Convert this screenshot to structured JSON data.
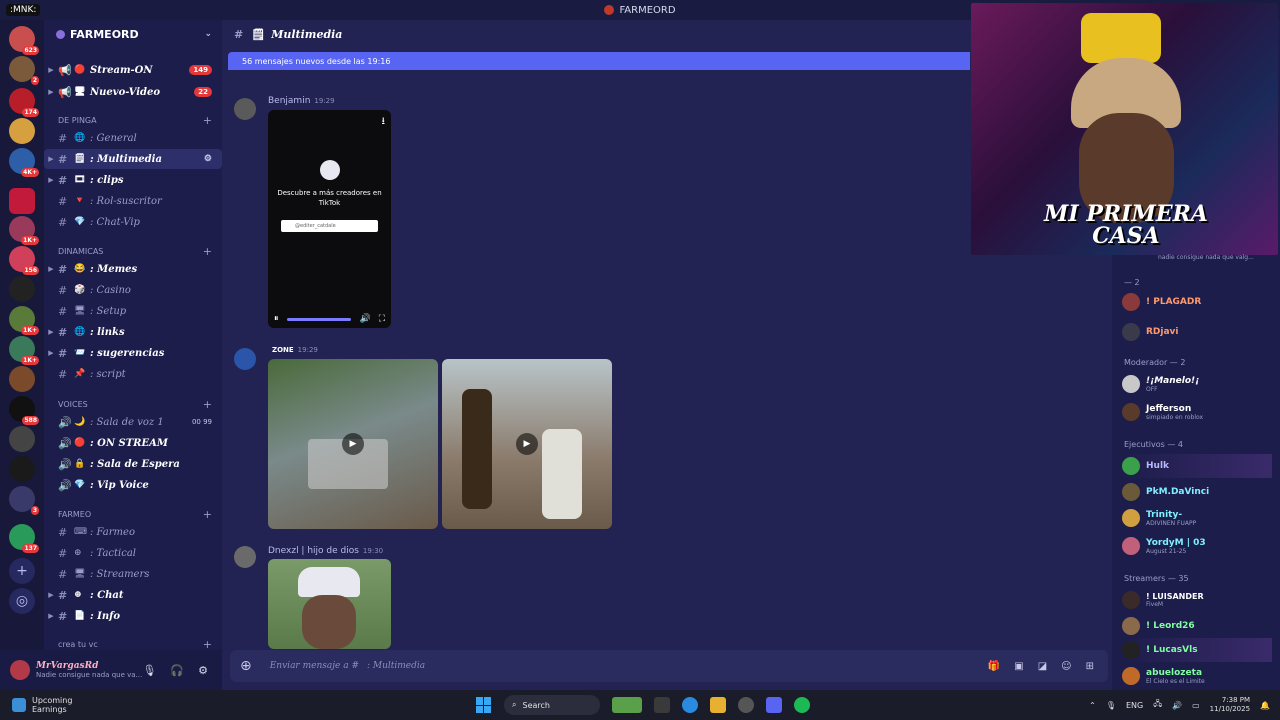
{
  "window": {
    "title": "FARMEORD",
    "overlay_tag": ":MNK:"
  },
  "guilds": {
    "badges": [
      "623",
      "2",
      "174",
      "8",
      "4K+",
      "1K+",
      "156",
      "1K+",
      "1K+",
      "588",
      "3",
      "137"
    ]
  },
  "server": {
    "name": "FARMEORD",
    "channels_top": [
      {
        "label": "Stream-ON",
        "count": "149"
      },
      {
        "label": "Nuevo-Video",
        "count": "22"
      }
    ],
    "categories": [
      {
        "name": "DE PINGA",
        "channels": [
          {
            "label": ": General"
          },
          {
            "label": ": Multimedia"
          },
          {
            "label": ": clips"
          },
          {
            "label": ": Rol-suscritor"
          },
          {
            "label": ": Chat-Vip"
          }
        ]
      },
      {
        "name": "DINAMICAS",
        "channels": [
          {
            "label": ": Memes"
          },
          {
            "label": ": Casino"
          },
          {
            "label": ": Setup"
          },
          {
            "label": ": links"
          },
          {
            "label": ": sugerencias"
          },
          {
            "label": ": script"
          }
        ]
      },
      {
        "name": "VOICES",
        "channels": [
          {
            "label": ": Sala de voz 1",
            "extra": "00  99"
          },
          {
            "label": ": ON STREAM"
          },
          {
            "label": ": Sala de Espera"
          },
          {
            "label": ": Vip Voice"
          }
        ]
      },
      {
        "name": "FARMEO",
        "channels": [
          {
            "label": ": Farmeo"
          },
          {
            "label": ": Tactical"
          },
          {
            "label": ": Streamers"
          },
          {
            "label": ": Chat"
          },
          {
            "label": ": Info"
          }
        ]
      },
      {
        "name": "crea tu vc",
        "channels": []
      }
    ]
  },
  "user": {
    "name": "MrVargasRd",
    "status": "Nadie consigue nada que va..."
  },
  "chat": {
    "channel": "Multimedia",
    "new_messages_bar": "56 mensajes nuevos desde las 19:16",
    "messages": [
      {
        "author": "Benjamin",
        "time": "19:29",
        "video": {
          "promo": "Descubre a más creadores en TikTok",
          "search": "@editer_catdale"
        }
      },
      {
        "author": "",
        "tag": "ZONE",
        "time": "19:29"
      },
      {
        "author": "Dnexzl | hijo de dios",
        "time": "19:30"
      }
    ],
    "composer_placeholder": "Enviar mensaje a # ",
    "composer_channel": ": Multimedia"
  },
  "members": {
    "groups": [
      {
        "title": "— 2",
        "members": [
          {
            "name": "! PLAGADR",
            "sub": "",
            "color": "#ff9a6c"
          },
          {
            "name": "RDjavi",
            "sub": "",
            "color": "#ff9a6c"
          }
        ]
      },
      {
        "title": "Moderador — 2",
        "members": [
          {
            "name": "!¡Manelo!¡",
            "sub": "OFF",
            "color": "#ffffff"
          },
          {
            "name": "Jefferson",
            "sub": "simpiado en roblox",
            "color": "#ffffff"
          }
        ]
      },
      {
        "title": "Ejecutivos — 4",
        "members": [
          {
            "name": "Hulk",
            "sub": "",
            "color": "#b8b8ff"
          },
          {
            "name": "PkM.DaVinci",
            "sub": "",
            "color": "#7ff0ff"
          },
          {
            "name": "Trinity-",
            "sub": "ADIVINEN FUAPP",
            "color": "#7ff0ff"
          },
          {
            "name": "YordyM | 03",
            "sub": "August 21-25",
            "color": "#7ff0ff"
          }
        ]
      },
      {
        "title": "Streamers — 35",
        "members": [
          {
            "name": "! LUISANDER",
            "sub": "FiveM",
            "color": "#ffffff"
          },
          {
            "name": "! Leord26",
            "sub": "",
            "color": "#7fff9f"
          },
          {
            "name": "! LucasVls",
            "sub": "",
            "color": "#7fff9f"
          },
          {
            "name": "abuelozeta",
            "sub": "El Cielo es el Limite",
            "color": "#7fff9f"
          }
        ]
      }
    ],
    "cam_caption": "MI PRIMERA CASA",
    "cam_status": "nadie consigue nada que valg..."
  },
  "taskbar": {
    "weather_title": "Upcoming",
    "weather_sub": "Earnings",
    "search": "Search",
    "lang": "ENG",
    "time": "7:38 PM",
    "date": "11/10/2025"
  }
}
